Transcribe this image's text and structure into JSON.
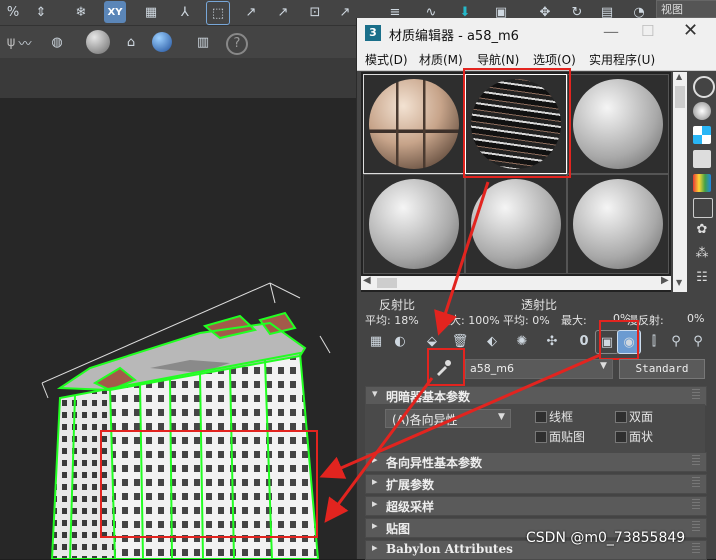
{
  "viewport": {
    "label": "视图"
  },
  "material_editor": {
    "title": "材质编辑器 - a58_m6",
    "menu": [
      "模式(D)",
      "材质(M)",
      "导航(N)",
      "选项(O)",
      "实用程序(U)"
    ],
    "stats": {
      "reflect_label": "反射比",
      "transmit_label": "透射比",
      "reflect_avg": "平均:  18%",
      "reflect_max": "最大:  100%",
      "transmit_avg": "平均:  0%",
      "transmit_max": "最大:",
      "transmit_max_val": "0%",
      "diffuse_label": "漫反射:",
      "diffuse_val": "0%"
    },
    "material_name": "a58_m6",
    "material_type": "Standard",
    "rollouts": {
      "shader_basic": "明暗器基本参数",
      "anisotropic": "各向异性基本参数",
      "extended": "扩展参数",
      "supersampling": "超级采样",
      "maps": "贴图",
      "babylon": "Babylon Attributes"
    },
    "shader": {
      "type": "(A)各向异性",
      "wire": "线框",
      "two_sided": "双面",
      "face_map": "面贴图",
      "faceted": "面状"
    }
  },
  "watermark": "CSDN @m0_73855849"
}
